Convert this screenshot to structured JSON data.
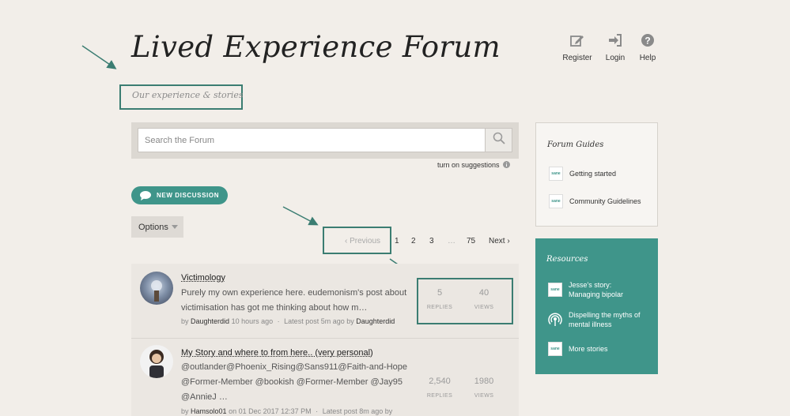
{
  "header": {
    "title": "Lived Experience Forum",
    "subtitle": "Our experience & stories",
    "nav": [
      {
        "label": "Register",
        "icon": "edit-icon"
      },
      {
        "label": "Login",
        "icon": "sign-in-icon"
      },
      {
        "label": "Help",
        "icon": "help-icon"
      }
    ]
  },
  "search": {
    "placeholder": "Search the Forum",
    "suggestions_label": "turn on suggestions"
  },
  "actions": {
    "new_discussion": "NEW DISCUSSION",
    "options": "Options"
  },
  "pagination": {
    "previous": "Previous",
    "pages": [
      "1",
      "2",
      "3",
      "…",
      "75"
    ],
    "next": "Next"
  },
  "discussions": [
    {
      "title": "Victimology",
      "excerpt": "Purely my own experience here. eudemonism's post about victimisation has got me thinking about how m…",
      "meta_by": "by",
      "author": "Daughterdid",
      "posted": "10 hours ago",
      "sep": "·",
      "latest_text": "Latest post 5m ago by",
      "latest_author": "Daughterdid",
      "replies": "5",
      "views": "40"
    },
    {
      "title": "My Story and where to from here.. (very personal)",
      "excerpt": "@outlander@Phoenix_Rising@Sans911@Faith-and-Hope @Former-Member @bookish @Former-Member @Jay95 @AnnieJ …",
      "meta_by": "by",
      "author": "Hamsolo01",
      "posted": "on 01 Dec 2017 12:37 PM",
      "sep": "·",
      "latest_text": "Latest post 8m ago by",
      "latest_author": "",
      "replies": "2,540",
      "views": "1980"
    }
  ],
  "stat_labels": {
    "replies": "REPLIES",
    "views": "VIEWS"
  },
  "sidebar": {
    "guides_title": "Forum Guides",
    "guides": [
      "Getting started",
      "Community Guidelines"
    ],
    "resources_title": "Resources",
    "resources": [
      {
        "label": "Jesse's story: Managing bipolar",
        "icon": "sane-logo-icon"
      },
      {
        "label": "Dispelling the myths of mental illness",
        "icon": "podcast-icon"
      },
      {
        "label": "More stories",
        "icon": "sane-logo-icon"
      }
    ],
    "sane_logo_text": "sane"
  },
  "colors": {
    "accent": "#3f958a",
    "annotation": "#3b7d72",
    "background": "#f2eee9"
  }
}
